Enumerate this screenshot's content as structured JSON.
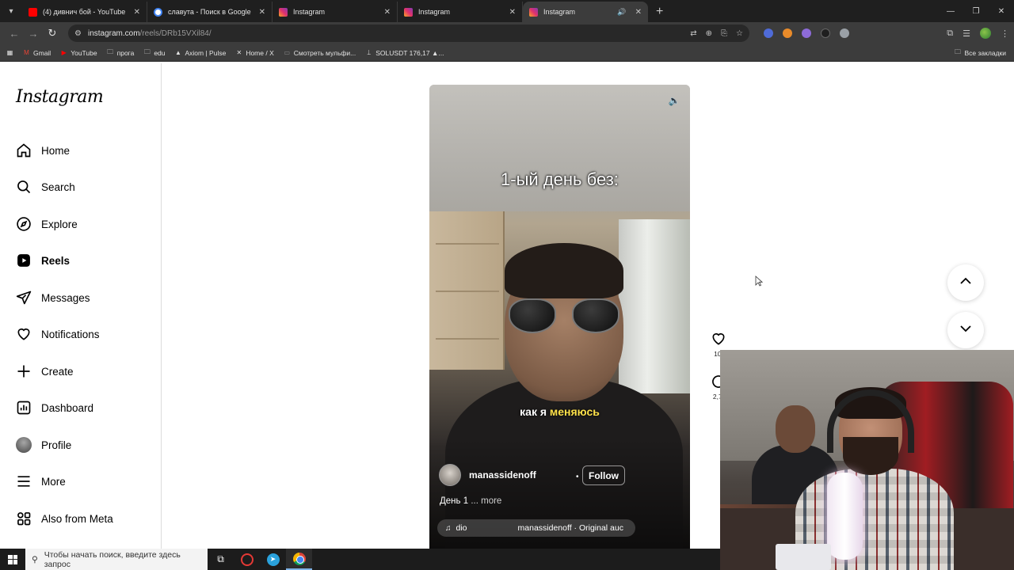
{
  "browser": {
    "tabs": [
      {
        "title": "(4) дивнич бой - YouTube",
        "favicon_color": "#ff0000"
      },
      {
        "title": "славута - Поиск в Google",
        "favicon_color": "#4285f4"
      },
      {
        "title": "Instagram",
        "favicon_color": "#e1306c"
      },
      {
        "title": "Instagram",
        "favicon_color": "#e1306c"
      },
      {
        "title": "Instagram",
        "favicon_color": "#e1306c",
        "active": true
      }
    ],
    "url_host": "instagram.com",
    "url_path": "/reels/DRb15VXil84/",
    "bookmarks": [
      {
        "label": "Gmail",
        "icon": "gmail-icon"
      },
      {
        "label": "YouTube",
        "icon": "youtube-icon"
      },
      {
        "label": "прога",
        "icon": "folder-icon"
      },
      {
        "label": "edu",
        "icon": "folder-icon"
      },
      {
        "label": "Axiom | Pulse",
        "icon": "axiom-icon"
      },
      {
        "label": "Home / X",
        "icon": "x-icon"
      },
      {
        "label": "Смотреть мульфи...",
        "icon": "site-icon"
      },
      {
        "label": "SOLUSDT 176,17 ▲...",
        "icon": "tradingview-icon"
      }
    ],
    "all_bookmarks": "Все закладки"
  },
  "instagram": {
    "logo": "Instagram",
    "nav": [
      {
        "label": "Home",
        "icon": "home-icon"
      },
      {
        "label": "Search",
        "icon": "search-icon"
      },
      {
        "label": "Explore",
        "icon": "compass-icon"
      },
      {
        "label": "Reels",
        "icon": "reels-icon",
        "active": true
      },
      {
        "label": "Messages",
        "icon": "messenger-icon"
      },
      {
        "label": "Notifications",
        "icon": "heart-icon"
      },
      {
        "label": "Create",
        "icon": "plus-icon"
      },
      {
        "label": "Dashboard",
        "icon": "dashboard-icon"
      },
      {
        "label": "Profile",
        "icon": "profile-avatar"
      },
      {
        "label": "More",
        "icon": "menu-icon"
      },
      {
        "label": "Also from Meta",
        "icon": "meta-apps-icon"
      }
    ],
    "reel": {
      "overlay_title": "1-ый день без:",
      "caption_plain": "как я",
      "caption_highlight": "меняюсь",
      "author": "manassidenoff",
      "dot": "•",
      "follow": "Follow",
      "description": "День 1",
      "more": "... more",
      "audio_left": "dio",
      "audio_track": "manassidenoff · Original auc"
    },
    "actions": {
      "likes": "10:",
      "comments": "2,7:"
    }
  },
  "taskbar": {
    "search_placeholder": "Чтобы начать поиск, введите здесь запрос"
  },
  "colors": {
    "accent_caption": "#ffe24a",
    "chrome_dark": "#1f1f1f"
  }
}
